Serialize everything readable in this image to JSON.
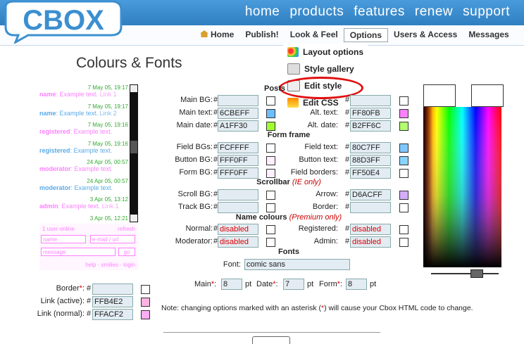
{
  "logo": {
    "text": "CBOX"
  },
  "topnav": [
    "home",
    "products",
    "features",
    "renew",
    "support"
  ],
  "subnav": [
    {
      "label": "Home",
      "icon": "house-icon"
    },
    {
      "label": "Publish!"
    },
    {
      "label": "Look & Feel"
    },
    {
      "label": "Options",
      "active": true
    },
    {
      "label": "Users & Access"
    },
    {
      "label": "Messages"
    }
  ],
  "dropdown": [
    {
      "label": "Layout options",
      "icon": "palette-icon"
    },
    {
      "label": "Style gallery",
      "icon": "gallery-icon"
    },
    {
      "label": "Edit style",
      "icon": "edit-style-icon",
      "highlighted": true
    },
    {
      "label": "Edit CSS",
      "icon": "css-icon"
    }
  ],
  "page_title": "Colours & Fonts",
  "chat": {
    "messages": [
      {
        "ts": "7 May 05, 19:17",
        "name": "name",
        "text": "Example text.",
        "link": "Link 1",
        "color": "#FF80FF"
      },
      {
        "ts": "7 May 05, 19:17",
        "name": "name",
        "text": "Example text.",
        "link": "Link 2",
        "color": "#5AAAE6"
      },
      {
        "ts": "7 May 05, 19:16",
        "name": "registered",
        "text": "Example text.",
        "link": "",
        "color": "#FF80FF"
      },
      {
        "ts": "7 May 05, 19:16",
        "name": "registered",
        "text": "Example text.",
        "link": "",
        "color": "#5AAAE6"
      },
      {
        "ts": "24 Apr 05, 00:57",
        "name": "moderator",
        "text": "Example text.",
        "link": "",
        "color": "#FF80FF"
      },
      {
        "ts": "24 Apr 05, 00:57",
        "name": "moderator",
        "text": "Example text.",
        "link": "",
        "color": "#5AAAE6"
      },
      {
        "ts": "3 Apr 05, 13:12",
        "name": "admin",
        "text": "Example text.",
        "link": "Link 1",
        "color": "#FF80FF"
      },
      {
        "ts": "3 Apr 05, 12:21",
        "name": "",
        "text": "",
        "link": "",
        "color": "#FF80FF"
      }
    ],
    "users_online": "1 user online",
    "refresh": "refresh",
    "name_placeholder": "name",
    "email_placeholder": "e-mail / url",
    "message_placeholder": "message",
    "go": "go",
    "footer": "help · smilies · login"
  },
  "left_fields": [
    {
      "label": "Border",
      "req": true,
      "value": "",
      "color": "#FFFFFF"
    },
    {
      "label": "Link (active):",
      "req": false,
      "value": "FFB4E2",
      "color": "#FFB4E2"
    },
    {
      "label": "Link (normal):",
      "req": false,
      "value": "FFACF2",
      "color": "#FFACF2"
    }
  ],
  "sections": {
    "posts": "Posts",
    "form_frame": "Form frame",
    "scrollbar": "Scrollbar",
    "scrollbar_note": "(IE only)",
    "name_colours": "Name colours",
    "name_colours_note": "(Premium only)",
    "fonts": "Fonts"
  },
  "posts": [
    {
      "label": "Main BG:",
      "value": "",
      "color": "#FFFFFF",
      "label2": "",
      "value2": "",
      "color2": "#FFFFFF"
    },
    {
      "label": "Main text:",
      "value": "6CBEFF",
      "color": "#6CBEFF",
      "label2": "Alt. text:",
      "value2": "FF80FB",
      "color2": "#FF80FB"
    },
    {
      "label": "Main date:",
      "value": "A1FF30",
      "color": "#A1FF30",
      "label2": "Alt. date:",
      "value2": "B2FF6C",
      "color2": "#B2FF6C"
    }
  ],
  "form_frame": [
    {
      "label": "Field BGs:",
      "value": "FCFFFF",
      "color": "#FCFFFF",
      "label2": "Field text:",
      "value2": "80C7FF",
      "color2": "#80C7FF"
    },
    {
      "label": "Button BG:",
      "value": "FFF0FF",
      "color": "#FFF0FF",
      "label2": "Button text:",
      "value2": "88D3FF",
      "color2": "#88D3FF"
    },
    {
      "label": "Form BG:",
      "value": "FFF0FF",
      "color": "#FFF0FF",
      "label2": "Field borders:",
      "value2": "FF50E4",
      "color2": "#FFFFFF"
    }
  ],
  "scrollbar_rows": [
    {
      "label": "Scroll BG:",
      "value": "",
      "color": "#FFFFFF",
      "label2": "Arrow:",
      "value2": "D6ACFF",
      "color2": "#D6ACFF"
    },
    {
      "label": "Track BG:",
      "value": "",
      "color": "#FFFFFF",
      "label2": "Border:",
      "value2": "",
      "color2": "#FFFFFF"
    }
  ],
  "name_rows": [
    {
      "label": "Normal:",
      "value": "disabled",
      "color": "#FFFFFF",
      "label2": "Registered:",
      "value2": "disabled",
      "color2": "#FFFFFF"
    },
    {
      "label": "Moderator:",
      "value": "disabled",
      "color": "#FFFFFF",
      "label2": "Admin:",
      "value2": "disabled",
      "color2": "#FFFFFF"
    }
  ],
  "font": {
    "label": "Font:",
    "value": "comic sans"
  },
  "sizes": [
    {
      "label": "Main",
      "value": "8",
      "unit": "pt"
    },
    {
      "label": "Date",
      "value": "7",
      "unit": "pt"
    },
    {
      "label": "Form",
      "value": "8",
      "unit": "pt"
    }
  ],
  "note": {
    "before": "Note: changing options marked with an asterisk (",
    "star": "*",
    "after": ") will cause your Cbox HTML code to change."
  },
  "palette": {
    "brightness_slider": 0.6
  }
}
